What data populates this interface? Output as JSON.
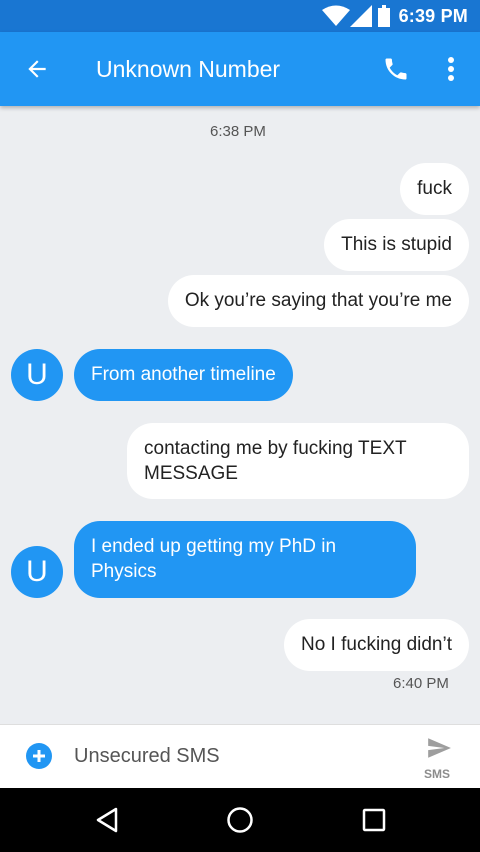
{
  "status_bar": {
    "time": "6:39 PM",
    "icons": [
      "wifi-icon",
      "signal-icon",
      "battery-icon"
    ]
  },
  "app_bar": {
    "title": "Unknown Number",
    "back_icon": "arrow-back-icon",
    "call_icon": "phone-icon",
    "menu_icon": "more-vert-icon"
  },
  "conversation": {
    "timestamps": [
      "6:38 PM",
      "6:40 PM"
    ],
    "messages": [
      {
        "direction": "outgoing",
        "text": "fuck"
      },
      {
        "direction": "outgoing",
        "text": "This is stupid"
      },
      {
        "direction": "outgoing",
        "text": "Ok you’re saying that you’re me"
      },
      {
        "direction": "incoming",
        "avatar": "U",
        "text": "From another timeline"
      },
      {
        "direction": "outgoing",
        "text": "contacting me by fucking TEXT MESSAGE"
      },
      {
        "direction": "incoming",
        "avatar": "U",
        "text": "I ended up getting my PhD in Physics"
      },
      {
        "direction": "outgoing",
        "text": "No I fucking didn’t"
      }
    ]
  },
  "composer": {
    "placeholder": "Unsecured SMS",
    "send_label": "SMS",
    "attach_icon": "add-circle-icon",
    "send_icon": "send-icon"
  },
  "nav_bar": {
    "icons": [
      "back-triangle-icon",
      "home-circle-icon",
      "recents-square-icon"
    ]
  },
  "colors": {
    "primary": "#2196f3",
    "primary_dark": "#1976d2",
    "background": "#eceef1"
  }
}
